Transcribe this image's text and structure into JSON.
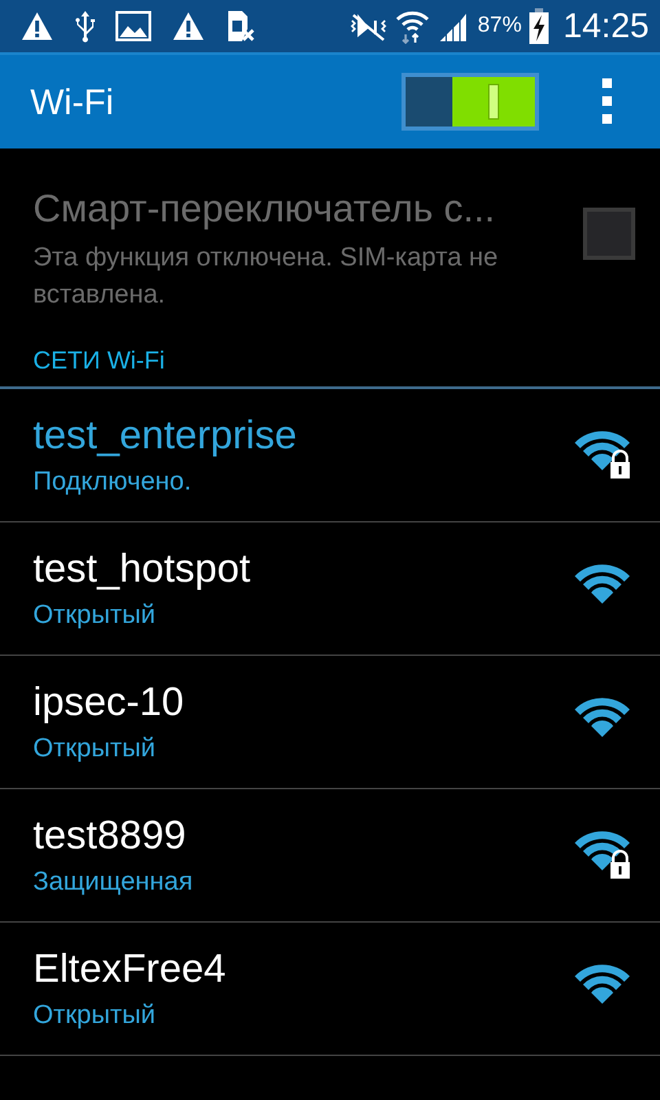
{
  "status_bar": {
    "battery_percent": "87%",
    "time": "14:25"
  },
  "action_bar": {
    "title": "Wi-Fi",
    "wifi_switch": {
      "on": true
    }
  },
  "smart_switch": {
    "title": "Смарт-переключатель с...",
    "summary": "Эта функция отключена. SIM-карта не вставлена.",
    "checked": false,
    "disabled": true
  },
  "section_header": "СЕТИ Wi-Fi",
  "networks": [
    {
      "name": "test_enterprise",
      "status": "Подключено.",
      "connected": true,
      "secured": true
    },
    {
      "name": "test_hotspot",
      "status": "Открытый",
      "connected": false,
      "secured": false
    },
    {
      "name": "ipsec-10",
      "status": "Открытый",
      "connected": false,
      "secured": false
    },
    {
      "name": "test8899",
      "status": "Защищенная",
      "connected": false,
      "secured": true
    },
    {
      "name": "EltexFree4",
      "status": "Открытый",
      "connected": false,
      "secured": false
    }
  ]
}
